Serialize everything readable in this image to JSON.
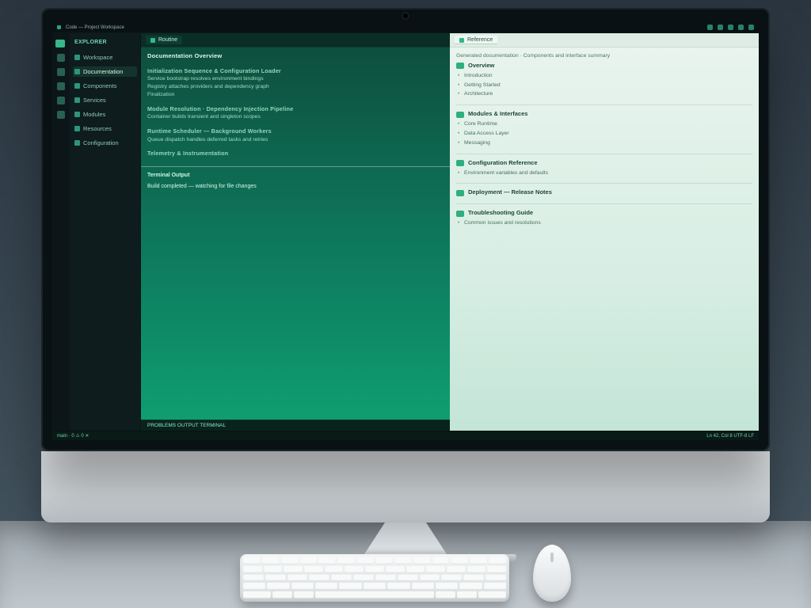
{
  "menubar": {
    "title": "Code — Project Workspace",
    "right_icons": [
      "git-icon",
      "debug-icon",
      "extensions-icon",
      "bell-icon",
      "settings-icon"
    ]
  },
  "activitybar": {
    "items": [
      "explorer",
      "search",
      "source-control",
      "debug",
      "extensions",
      "account"
    ]
  },
  "sidebar": {
    "title": "EXPLORER",
    "items": [
      {
        "label": "Workspace"
      },
      {
        "label": "Documentation"
      },
      {
        "label": "Components"
      },
      {
        "label": "Services"
      },
      {
        "label": "Modules"
      },
      {
        "label": "Resources"
      },
      {
        "label": "Configuration"
      }
    ],
    "selected_index": 1
  },
  "left_pane": {
    "tab_label": "Routine",
    "heading": "Documentation Overview",
    "blocks": [
      {
        "title": "Initialization Sequence & Configuration Loader",
        "lines": [
          "Service bootstrap resolves environment bindings",
          "Registry attaches providers and dependency graph",
          "Finalization"
        ]
      },
      {
        "title": "Module Resolution · Dependency Injection Pipeline",
        "lines": [
          "Container builds transient and singleton scopes"
        ]
      },
      {
        "title": "Runtime Scheduler — Background Workers",
        "lines": [
          "Queue dispatch handles deferred tasks and retries"
        ]
      },
      {
        "title": "Telemetry & Instrumentation",
        "lines": []
      }
    ],
    "lower_heading": "Terminal Output",
    "lower_line": "Build completed — watching for file changes"
  },
  "right_pane": {
    "tab_label": "Reference",
    "subtitle": "Generated documentation · Components and interface summary",
    "sections": [
      {
        "title": "Overview",
        "bullets": [
          "Introduction",
          "Getting Started",
          "Architecture"
        ]
      },
      {
        "title": "Modules & Interfaces",
        "bullets": [
          "Core Runtime",
          "Data Access Layer",
          "Messaging"
        ]
      },
      {
        "title": "Configuration Reference",
        "bullets": [
          "Environment variables and defaults"
        ]
      },
      {
        "title": "Deployment — Release Notes",
        "bullets": []
      },
      {
        "title": "Troubleshooting Guide",
        "bullets": [
          "Common issues and resolutions"
        ]
      }
    ]
  },
  "terminal": {
    "label": "PROBLEMS  OUTPUT  TERMINAL"
  },
  "statusbar": {
    "left": "main ·  0 ⚠ 0 ✕",
    "right": "Ln 42, Col 8   UTF-8   LF"
  }
}
